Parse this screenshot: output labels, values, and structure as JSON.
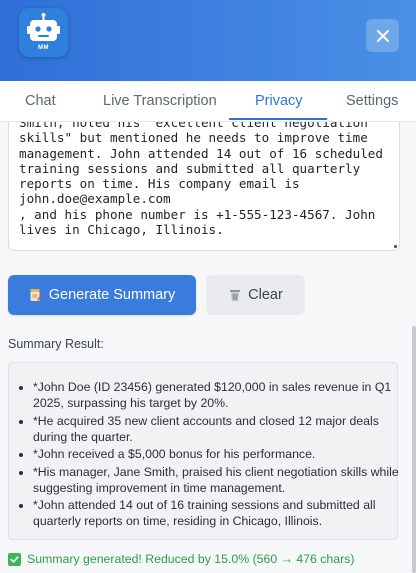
{
  "header": {
    "logo_text": "MM",
    "close_icon": "close-icon"
  },
  "tabs": [
    {
      "label": "Chat"
    },
    {
      "label": "Live Transcription"
    },
    {
      "label": "Privacy",
      "active": true
    },
    {
      "label": "Settings"
    }
  ],
  "input": {
    "text": "Smith, noted his \"excellent client negotiation skills\" but mentioned he needs to improve time management. John attended 14 out of 16 scheduled training sessions and submitted all quarterly reports on time. His company email is\njohn.doe@example.com\n, and his phone number is +1-555-123-4567. John lives in Chicago, Illinois."
  },
  "actions": {
    "generate_label": "Generate Summary",
    "generate_icon": "document-pencil-icon",
    "clear_label": "Clear",
    "clear_icon": "trash-icon"
  },
  "summary": {
    "label": "Summary Result:",
    "items": [
      "*John Doe (ID 23456) generated $120,000 in sales revenue in Q1 2025, surpassing his target by 20%.",
      "*He acquired 35 new client accounts and closed 12 major deals during the quarter.",
      "*John received a $5,000 bonus for his performance.",
      "*His manager, Jane Smith, praised his client negotiation skills while suggesting improvement in time management.",
      "*John attended 14 out of 16 training sessions and submitted all quarterly reports on time, residing in Chicago, Illinois."
    ]
  },
  "status": {
    "text": "Summary generated! Reduced by 15.0% (560 → 476 chars)",
    "color": "#2e9d4a"
  },
  "colors": {
    "brand": "#2f6fd8",
    "accent": "#3a7bde"
  }
}
